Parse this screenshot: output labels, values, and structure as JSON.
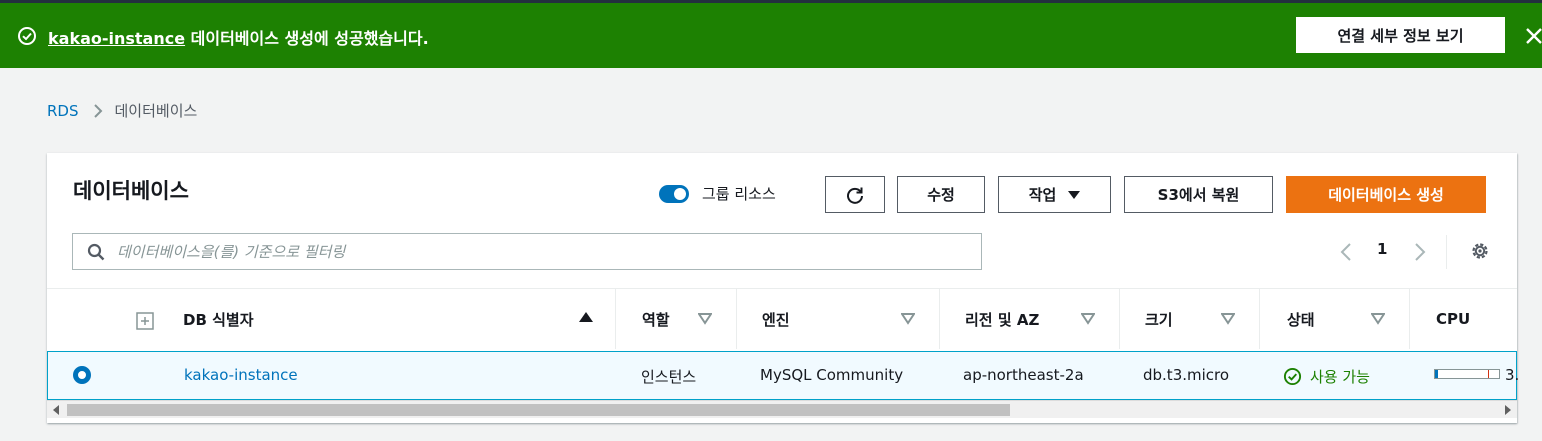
{
  "flash": {
    "instance_link": "kakao-instance",
    "message": " 데이터베이스 생성에 성공했습니다.",
    "details_button": "연결 세부 정보 보기",
    "icon": "check-circle-icon",
    "close_icon": "close-icon",
    "color": "#1d8102"
  },
  "breadcrumb": {
    "root": "RDS",
    "current": "데이터베이스"
  },
  "panel": {
    "title": "데이터베이스",
    "group_resources_label": "그룹 리소스",
    "group_resources_on": true,
    "buttons": {
      "refresh_icon": "refresh-icon",
      "modify": "수정",
      "actions": "작업",
      "restore_s3": "S3에서 복원",
      "create": "데이터베이스 생성"
    },
    "search": {
      "placeholder": "데이터베이스을(를) 기준으로 필터링",
      "value": ""
    },
    "pagination": {
      "current_page": "1"
    },
    "accent_color": "#ec7211"
  },
  "table": {
    "columns": [
      "DB 식별자",
      "역할",
      "엔진",
      "리전 및 AZ",
      "크기",
      "상태",
      "CPU"
    ],
    "rows": [
      {
        "selected": true,
        "identifier": "kakao-instance",
        "role": "인스턴스",
        "engine": "MySQL Community",
        "region_az": "ap-northeast-2a",
        "size": "db.t3.micro",
        "status": "사용 가능",
        "cpu_text": "3.",
        "cpu_fraction": 0.04
      }
    ]
  }
}
